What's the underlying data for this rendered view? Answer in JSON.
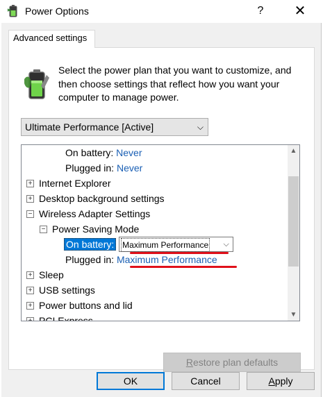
{
  "window": {
    "title": "Power Options",
    "help_glyph": "?",
    "close_glyph": "✕"
  },
  "tab": {
    "label": "Advanced settings"
  },
  "intro_text": "Select the power plan that you want to customize, and then choose settings that reflect how you want your computer to manage power.",
  "plan_select": {
    "value": "Ultimate Performance [Active]",
    "chevron": "⌵"
  },
  "tree": {
    "rows": [
      {
        "label": "On battery:",
        "value": "Never"
      },
      {
        "label": "Plugged in:",
        "value": "Never"
      },
      {
        "label": "Internet Explorer",
        "expander": "+"
      },
      {
        "label": "Desktop background settings",
        "expander": "+"
      },
      {
        "label": "Wireless Adapter Settings",
        "expander": "−"
      },
      {
        "label": "Power Saving Mode",
        "expander": "−"
      },
      {
        "label": "On battery:",
        "value": "Maximum Performance"
      },
      {
        "label": "Plugged in:",
        "value": "Maximum Performance"
      },
      {
        "label": "Sleep",
        "expander": "+"
      },
      {
        "label": "USB settings",
        "expander": "+"
      },
      {
        "label": "Power buttons and lid",
        "expander": "+"
      },
      {
        "label": "PCI Express",
        "expander": "+"
      }
    ],
    "scroll_up": "▲",
    "scroll_down": "▼"
  },
  "restore": {
    "label_first": "R",
    "label_rest": "estore plan defaults"
  },
  "buttons": {
    "ok": "OK",
    "cancel": "Cancel",
    "apply_first": "A",
    "apply_rest": "pply"
  },
  "colors": {
    "link": "#1a5fb4",
    "selection": "#0078d7",
    "annotation_red": "#e0101a"
  },
  "icons": [
    "power-options-icon",
    "help-icon",
    "close-icon",
    "battery-icon",
    "chevron-down-icon",
    "expand-icon",
    "collapse-icon",
    "scroll-up-icon",
    "scroll-down-icon"
  ]
}
